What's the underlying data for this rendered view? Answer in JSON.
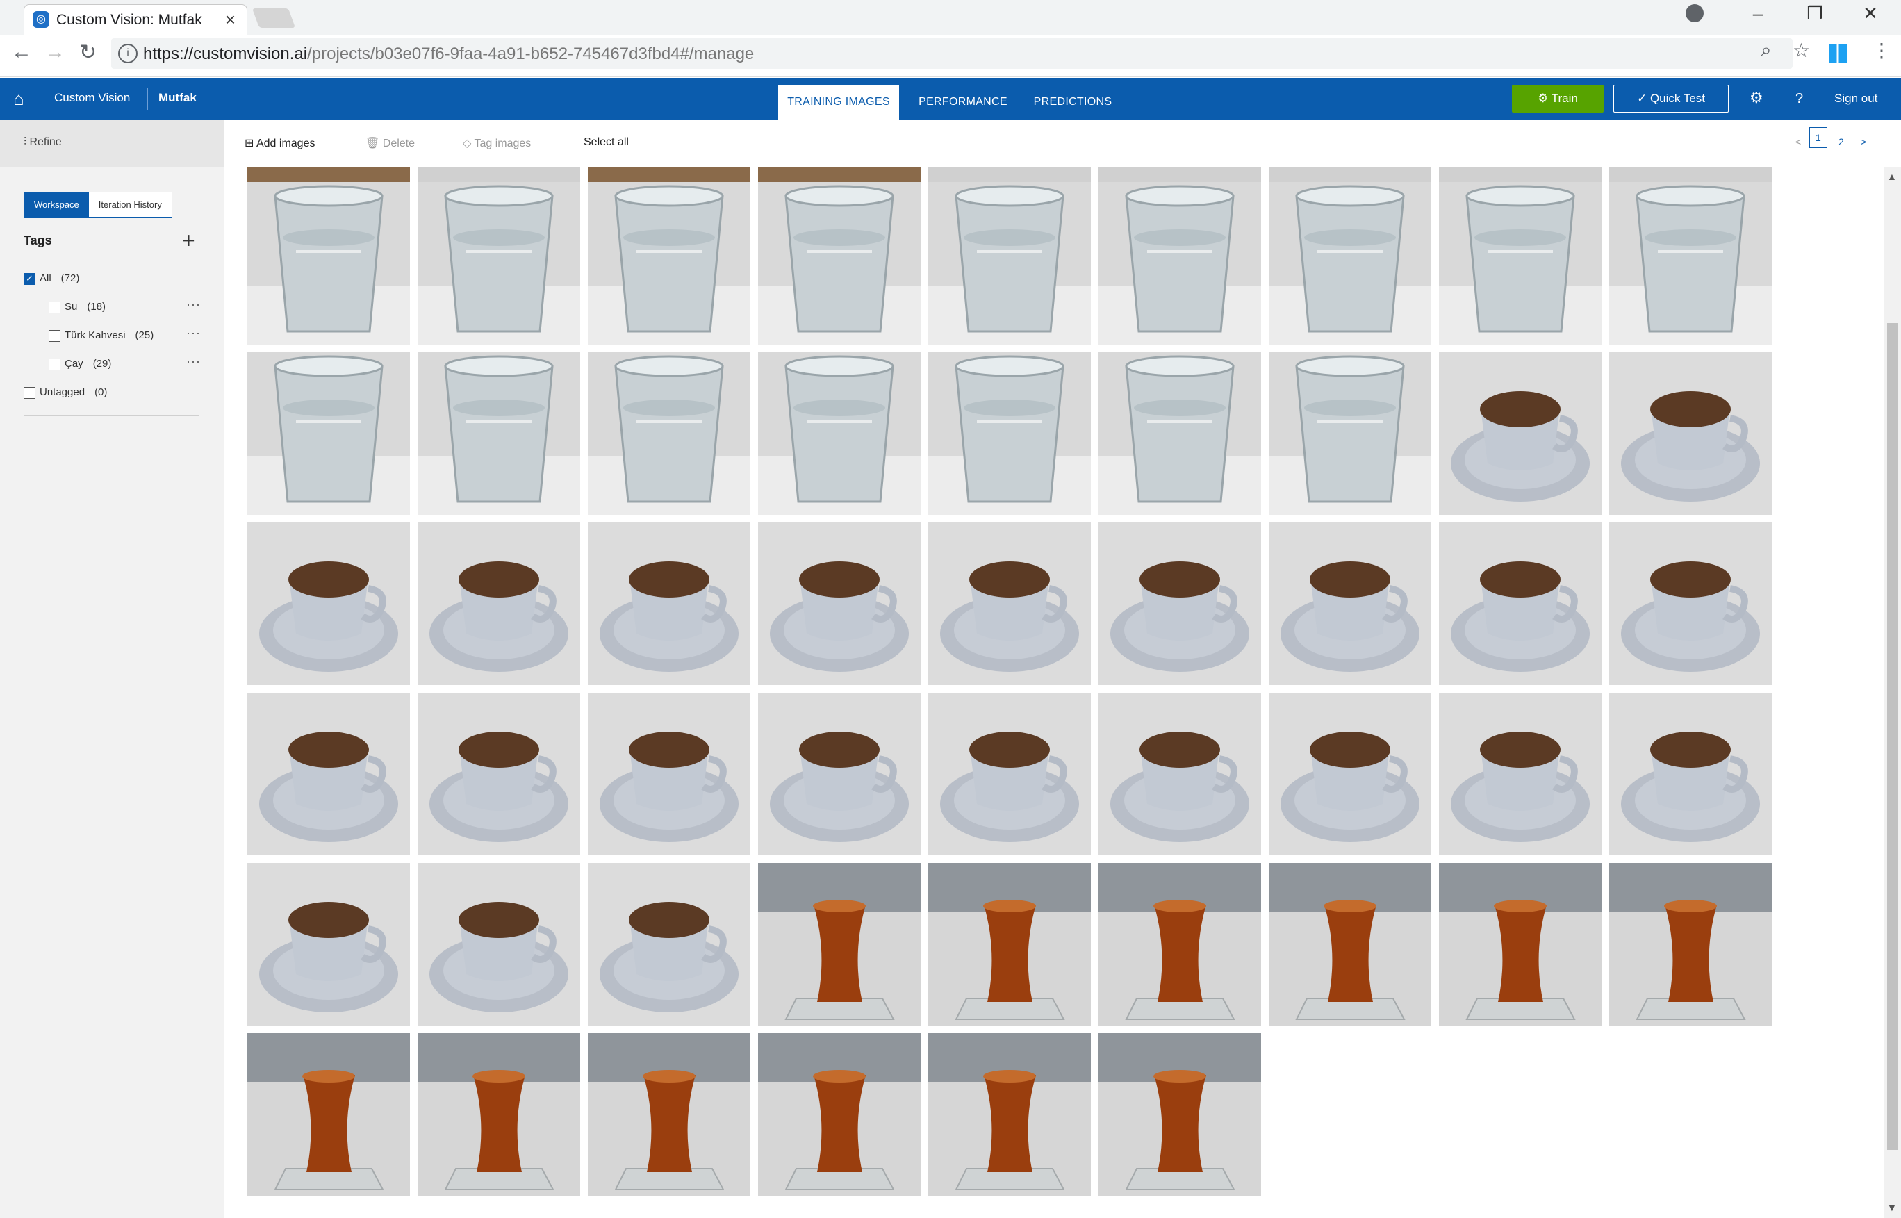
{
  "browser": {
    "tab_title": "Custom Vision: Mutfak",
    "url_host": "https://customvision.ai",
    "url_path": "/projects/b03e07f6-9faa-4a91-b652-745467d3fbd4#/manage"
  },
  "app": {
    "crumb_root": "Custom Vision",
    "crumb_project": "Mutfak",
    "tabs": [
      "TRAINING IMAGES",
      "PERFORMANCE",
      "PREDICTIONS"
    ],
    "active_tab": "TRAINING IMAGES",
    "train_label": "Train",
    "quicktest_label": "Quick Test",
    "help_label": "?",
    "signout_label": "Sign out",
    "brand_color": "#0b5cad",
    "train_color": "#57a300"
  },
  "toolbar": {
    "refine_label": "Refine",
    "add_images_label": "Add images",
    "delete_label": "Delete",
    "tag_images_label": "Tag images",
    "select_all_label": "Select all",
    "pages": [
      "1",
      "2"
    ],
    "current_page": "1",
    "prev": "<",
    "next": ">"
  },
  "sidebar": {
    "segments": [
      "Workspace",
      "Iteration History"
    ],
    "active_segment": "Workspace",
    "tags_title": "Tags",
    "all": {
      "label": "All",
      "count": "(72)",
      "checked": true
    },
    "tags": [
      {
        "label": "Su",
        "count": "(18)"
      },
      {
        "label": "Türk Kahvesi",
        "count": "(25)"
      },
      {
        "label": "Çay",
        "count": "(29)"
      }
    ],
    "untagged": {
      "label": "Untagged",
      "count": "(0)"
    }
  },
  "grid": {
    "columns": 9,
    "images": [
      "water",
      "water",
      "water",
      "water",
      "water",
      "water",
      "water",
      "water",
      "water",
      "water",
      "water",
      "water",
      "water",
      "water",
      "water",
      "water",
      "coffee",
      "coffee",
      "coffee",
      "coffee",
      "coffee",
      "coffee",
      "coffee",
      "coffee",
      "coffee",
      "coffee",
      "coffee",
      "coffee",
      "coffee",
      "coffee",
      "coffee",
      "coffee",
      "coffee",
      "coffee",
      "coffee",
      "coffee",
      "coffee",
      "coffee",
      "coffee",
      "tea",
      "tea",
      "tea",
      "tea",
      "tea",
      "tea",
      "tea",
      "tea",
      "tea",
      "tea",
      "tea",
      "tea"
    ]
  }
}
